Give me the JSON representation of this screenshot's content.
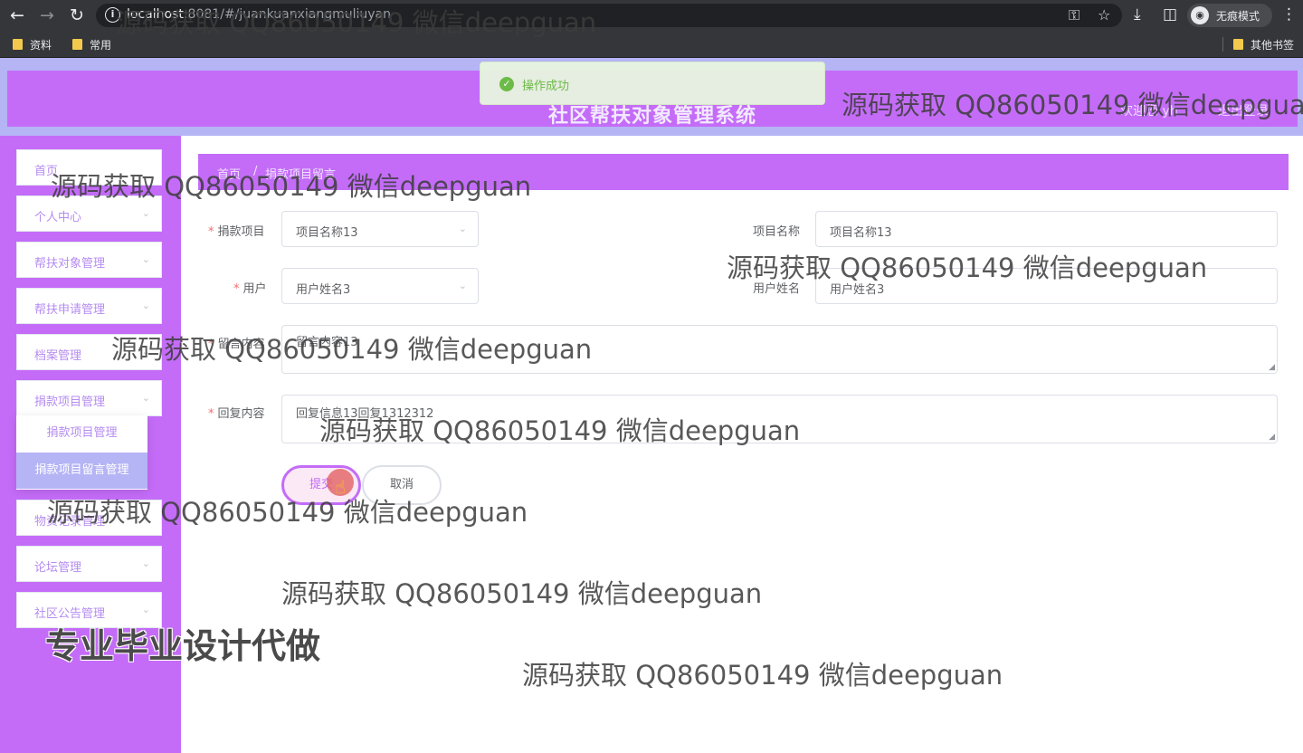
{
  "browser": {
    "url_host": "localhost",
    "url_path": ":8081/#/juankuanxiangmuliuyan",
    "incognito_label": "无痕模式",
    "bookmarks": [
      "资料",
      "常用"
    ],
    "other_bookmarks": "其他书签"
  },
  "header": {
    "title": "社区帮扶对象管理系统",
    "user_text": "欢迎您 yh",
    "logout": "退出登录"
  },
  "toast": {
    "message": "操作成功",
    "color": "#67c23a"
  },
  "sidebar": {
    "items": [
      {
        "label": "首页",
        "has_arrow": false
      },
      {
        "label": "个人中心",
        "has_arrow": true
      },
      {
        "label": "帮扶对象管理",
        "has_arrow": true
      },
      {
        "label": "帮扶申请管理",
        "has_arrow": true
      },
      {
        "label": "档案管理",
        "has_arrow": true
      },
      {
        "label": "捐款项目管理",
        "has_arrow": true
      },
      {
        "label": "物资记录管理",
        "has_arrow": true
      },
      {
        "label": "论坛管理",
        "has_arrow": true
      },
      {
        "label": "社区公告管理",
        "has_arrow": true
      }
    ],
    "submenu": [
      "捐款项目管理",
      "捐款项目留言管理"
    ]
  },
  "breadcrumb": {
    "home": "首页",
    "separator": "/",
    "current": "捐款项目留言"
  },
  "form": {
    "project_label": "捐款项目",
    "project_value": "项目名称13",
    "project_name_label": "项目名称",
    "project_name_value": "项目名称13",
    "user_label": "用户",
    "user_value": "用户姓名3",
    "user_name_label": "用户姓名",
    "user_name_value": "用户姓名3",
    "message_label": "留言内容",
    "message_value": "留言内容13",
    "reply_label": "回复内容",
    "reply_value": "回复信息13回复1312312",
    "submit": "提交",
    "cancel": "取消"
  },
  "watermark": {
    "text": "源码获取 QQ86050149 微信deepguan",
    "top_text": "源码获取 QQ86050149 微信deepguan",
    "banner": "专业毕业设计代做"
  },
  "colors": {
    "accent": "#c46cf8",
    "header_band": "#b5b4f5",
    "menu_text": "#b58cf0",
    "required": "#f56c6c"
  }
}
